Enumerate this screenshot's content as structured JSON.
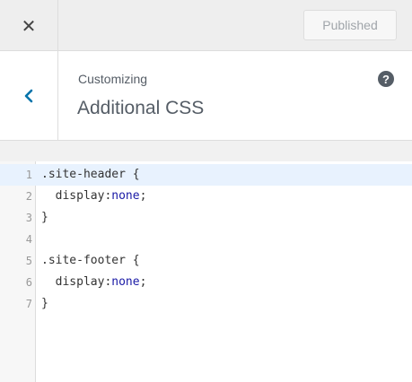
{
  "topbar": {
    "close_icon": "close-icon",
    "publish_label": "Published"
  },
  "section": {
    "back_icon": "chevron-left-icon",
    "breadcrumb": "Customizing",
    "title": "Additional CSS",
    "help_icon": "help-icon",
    "help_glyph": "?"
  },
  "editor": {
    "lines": [
      {
        "number": "1",
        "text": ".site-header {"
      },
      {
        "number": "2",
        "prop": "  display:",
        "value": "none",
        "end": ";"
      },
      {
        "number": "3",
        "text": "}"
      },
      {
        "number": "4",
        "text": ""
      },
      {
        "number": "5",
        "text": ".site-footer {"
      },
      {
        "number": "6",
        "prop": "  display:",
        "value": "none",
        "end": ";"
      },
      {
        "number": "7",
        "text": "}"
      }
    ],
    "colors": {
      "active_line": "#e8f2fe",
      "value": "#1a1aa6"
    }
  }
}
